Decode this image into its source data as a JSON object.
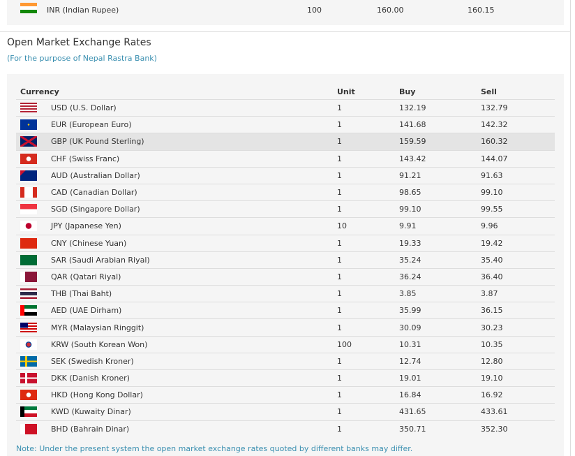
{
  "top_row": {
    "code": "INR",
    "label": "INR (Indian Rupee)",
    "unit": "100",
    "buy": "160.00",
    "sell": "160.15"
  },
  "section": {
    "title": "Open Market Exchange Rates",
    "subtitle": "(For the purpose of Nepal Rastra Bank)"
  },
  "table": {
    "headers": {
      "currency": "Currency",
      "unit": "Unit",
      "buy": "Buy",
      "sell": "Sell"
    },
    "rows": [
      {
        "code": "USD",
        "label": "USD (U.S. Dollar)",
        "unit": "1",
        "buy": "132.19",
        "sell": "132.79"
      },
      {
        "code": "EUR",
        "label": "EUR (European Euro)",
        "unit": "1",
        "buy": "141.68",
        "sell": "142.32"
      },
      {
        "code": "GBP",
        "label": "GBP (UK Pound Sterling)",
        "unit": "1",
        "buy": "159.59",
        "sell": "160.32"
      },
      {
        "code": "CHF",
        "label": "CHF (Swiss Franc)",
        "unit": "1",
        "buy": "143.42",
        "sell": "144.07"
      },
      {
        "code": "AUD",
        "label": "AUD (Australian Dollar)",
        "unit": "1",
        "buy": "91.21",
        "sell": "91.63"
      },
      {
        "code": "CAD",
        "label": "CAD (Canadian Dollar)",
        "unit": "1",
        "buy": "98.65",
        "sell": "99.10"
      },
      {
        "code": "SGD",
        "label": "SGD (Singapore Dollar)",
        "unit": "1",
        "buy": "99.10",
        "sell": "99.55"
      },
      {
        "code": "JPY",
        "label": "JPY (Japanese Yen)",
        "unit": "10",
        "buy": "9.91",
        "sell": "9.96"
      },
      {
        "code": "CNY",
        "label": "CNY (Chinese Yuan)",
        "unit": "1",
        "buy": "19.33",
        "sell": "19.42"
      },
      {
        "code": "SAR",
        "label": "SAR (Saudi Arabian Riyal)",
        "unit": "1",
        "buy": "35.24",
        "sell": "35.40"
      },
      {
        "code": "QAR",
        "label": "QAR (Qatari Riyal)",
        "unit": "1",
        "buy": "36.24",
        "sell": "36.40"
      },
      {
        "code": "THB",
        "label": "THB (Thai Baht)",
        "unit": "1",
        "buy": "3.85",
        "sell": "3.87"
      },
      {
        "code": "AED",
        "label": "AED (UAE Dirham)",
        "unit": "1",
        "buy": "35.99",
        "sell": "36.15"
      },
      {
        "code": "MYR",
        "label": "MYR (Malaysian Ringgit)",
        "unit": "1",
        "buy": "30.09",
        "sell": "30.23"
      },
      {
        "code": "KRW",
        "label": "KRW (South Korean Won)",
        "unit": "100",
        "buy": "10.31",
        "sell": "10.35"
      },
      {
        "code": "SEK",
        "label": "SEK (Swedish Kroner)",
        "unit": "1",
        "buy": "12.74",
        "sell": "12.80"
      },
      {
        "code": "DKK",
        "label": "DKK (Danish Kroner)",
        "unit": "1",
        "buy": "19.01",
        "sell": "19.10"
      },
      {
        "code": "HKD",
        "label": "HKD (Hong Kong Dollar)",
        "unit": "1",
        "buy": "16.84",
        "sell": "16.92"
      },
      {
        "code": "KWD",
        "label": "KWD (Kuwaity Dinar)",
        "unit": "1",
        "buy": "431.65",
        "sell": "433.61"
      },
      {
        "code": "BHD",
        "label": "BHD (Bahrain Dinar)",
        "unit": "1",
        "buy": "350.71",
        "sell": "352.30"
      }
    ],
    "highlighted_code": "GBP"
  },
  "note": "Note: Under the present system the open market exchange rates quoted by different banks may differ.",
  "colors": {
    "accent": "#3a8fb0",
    "panel_bg": "#f5f5f5",
    "highlight": "#e4e4e4"
  }
}
